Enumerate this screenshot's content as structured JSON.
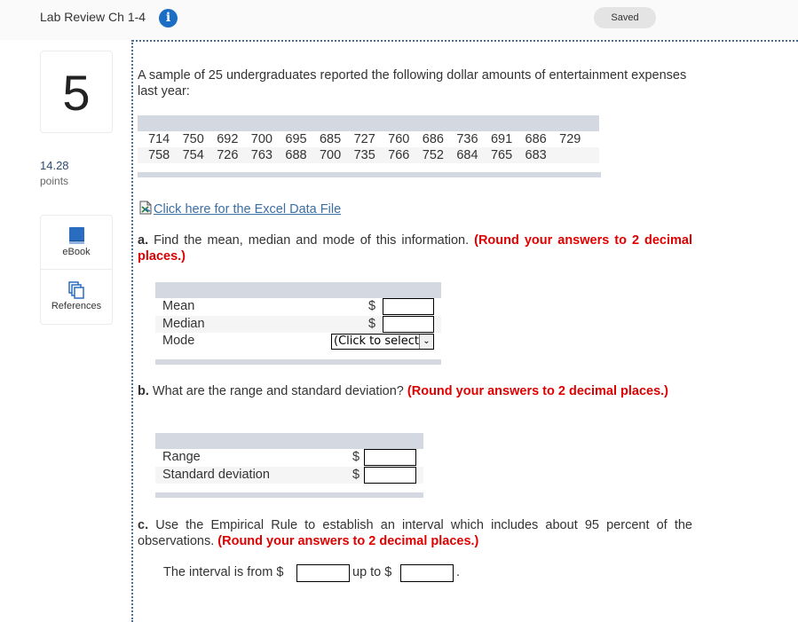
{
  "header": {
    "title": "Lab Review Ch 1-4",
    "info_icon": "info-icon",
    "saved_label": "Saved"
  },
  "sidebar": {
    "question_number": "5",
    "points_value": "14.28",
    "points_label": "points",
    "tools": [
      {
        "label": "eBook",
        "icon": "book-icon"
      },
      {
        "label": "References",
        "icon": "references-icon"
      }
    ]
  },
  "question": {
    "intro": "A sample of 25 undergraduates reported the following dollar amounts of entertainment expenses last year:",
    "data_rows": [
      [
        "714",
        "750",
        "692",
        "700",
        "695",
        "685",
        "727",
        "760",
        "686",
        "736",
        "691",
        "686",
        "729"
      ],
      [
        "758",
        "754",
        "726",
        "763",
        "688",
        "700",
        "735",
        "766",
        "752",
        "684",
        "765",
        "683"
      ]
    ],
    "excel_link": "Click here for the Excel Data File",
    "excel_icon": "excel-file-icon"
  },
  "part_a": {
    "lead": "a.",
    "text": "Find the mean, median and mode of this information.",
    "instruction": "(Round your answers to 2 decimal places.)",
    "rows": [
      {
        "label": "Mean",
        "currency": "$",
        "value": ""
      },
      {
        "label": "Median",
        "currency": "$",
        "value": ""
      },
      {
        "label": "Mode",
        "select_value": "(Click to select)"
      }
    ]
  },
  "part_b": {
    "lead": "b.",
    "text": "What are the range and standard deviation?",
    "instruction": "(Round your answers to 2 decimal places.)",
    "rows": [
      {
        "label": "Range",
        "currency": "$",
        "value": ""
      },
      {
        "label": "Standard deviation",
        "currency": "$",
        "value": ""
      }
    ]
  },
  "part_c": {
    "lead": "c.",
    "text": "Use the Empirical Rule to establish an interval which includes about 95 percent of the observations.",
    "instruction": "(Round your answers to 2 decimal places.)",
    "interval_prefix": "The interval is from $",
    "interval_middle": "up to $",
    "interval_suffix": ".",
    "from_value": "",
    "to_value": ""
  }
}
